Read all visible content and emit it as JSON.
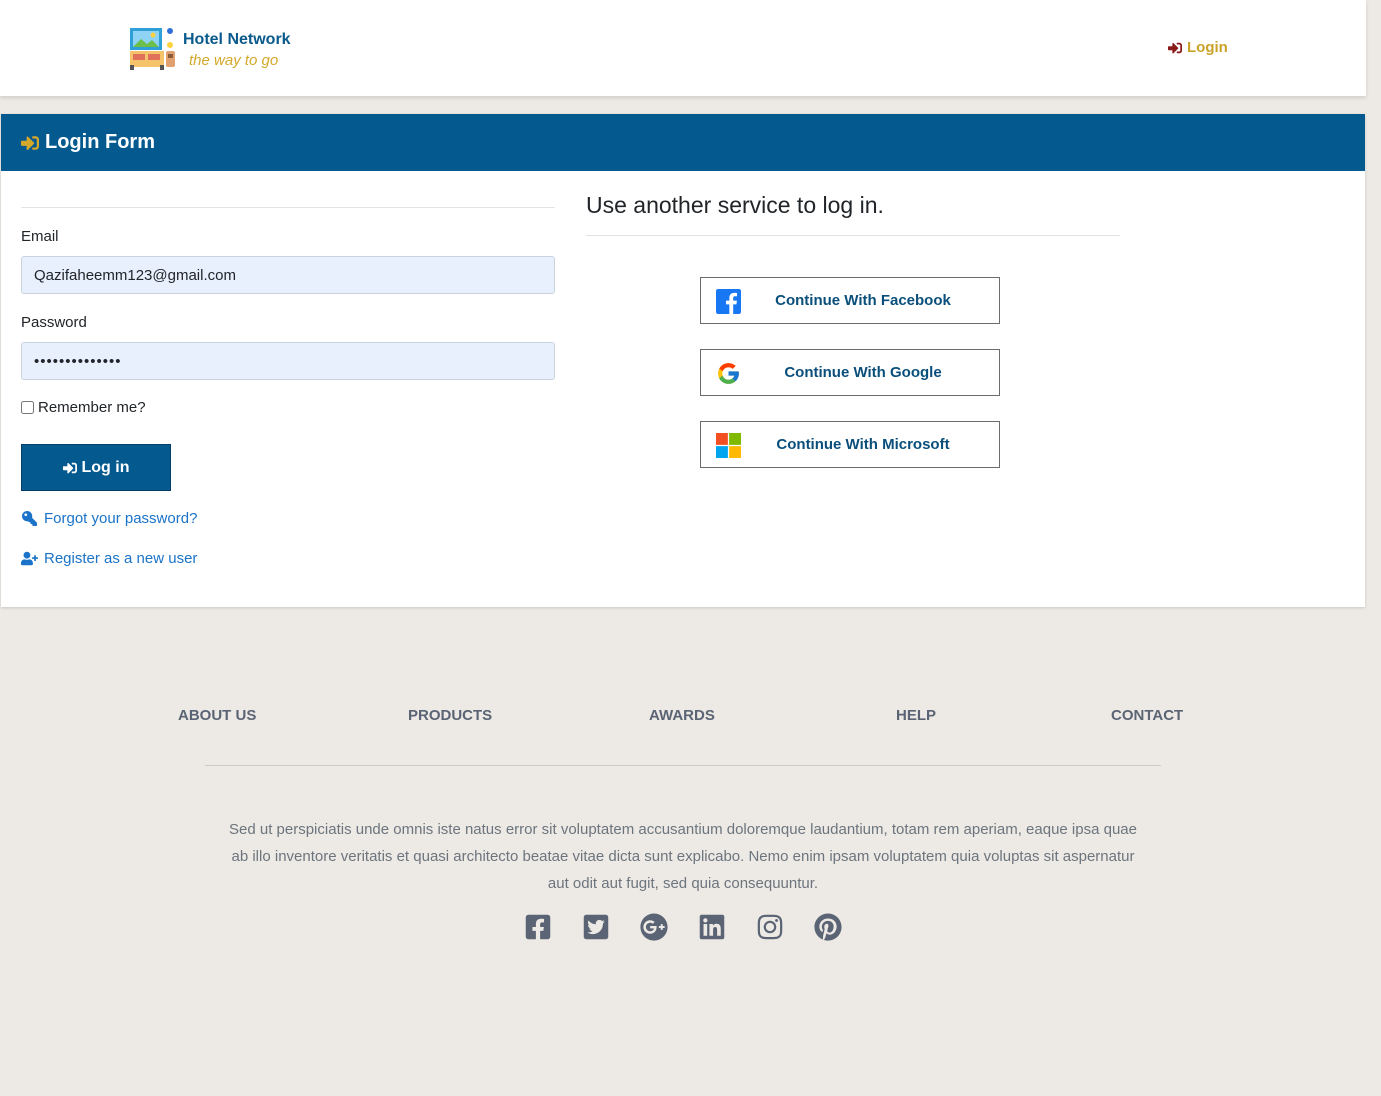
{
  "header": {
    "brand_name": "Hotel Network",
    "brand_tagline": "the way to go",
    "login_label": "Login",
    "logo_icon": "hotel-logo-icon"
  },
  "form": {
    "title": "Login Form",
    "email_label": "Email",
    "email_value": "Qazifaheemm123@gmail.com",
    "password_label": "Password",
    "password_value": "••••••••••••••",
    "remember_label": "Remember me?",
    "remember_checked": false,
    "submit_label": "Log in",
    "forgot_label": "Forgot your password?",
    "register_label": "Register as a new user"
  },
  "external": {
    "title": "Use another service to log in.",
    "providers": [
      {
        "label": "Continue With Facebook",
        "icon": "facebook-icon"
      },
      {
        "label": "Continue With Google",
        "icon": "google-icon"
      },
      {
        "label": "Continue With Microsoft",
        "icon": "microsoft-icon"
      }
    ]
  },
  "footer": {
    "nav": [
      "ABOUT US",
      "PRODUCTS",
      "AWARDS",
      "HELP",
      "CONTACT"
    ],
    "text": "Sed ut perspiciatis unde omnis iste natus error sit voluptatem accusantium doloremque laudantium, totam rem aperiam, eaque ipsa quae ab illo inventore veritatis et quasi architecto beatae vitae dicta sunt explicabo. Nemo enim ipsam voluptatem quia voluptas sit aspernatur aut odit aut fugit, sed quia consequuntur.",
    "social_icons": [
      "facebook-square-icon",
      "twitter-square-icon",
      "google-plus-icon",
      "linkedin-icon",
      "instagram-icon",
      "pinterest-icon"
    ]
  },
  "colors": {
    "primary": "#045a8f",
    "accent": "#c9a227",
    "link": "#1a73c8",
    "page_bg": "#ede9e5",
    "footer_text": "#5a6474"
  }
}
